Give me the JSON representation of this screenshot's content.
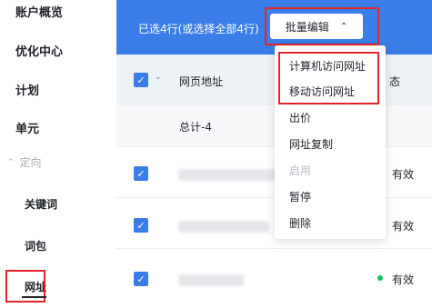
{
  "sidebar": {
    "items": [
      {
        "label": "账户概览"
      },
      {
        "label": "优化中心"
      },
      {
        "label": "计划"
      },
      {
        "label": "单元"
      }
    ],
    "section_label": "定向",
    "sub_items": [
      {
        "label": "关键词"
      },
      {
        "label": "词包"
      },
      {
        "label": "网址"
      }
    ]
  },
  "toolbar": {
    "selection_text": "已选4行(或选择全部4行)",
    "bulk_edit_label": "批量编辑"
  },
  "table": {
    "columns": [
      "网页地址",
      "态"
    ],
    "total_label": "总计-4",
    "rows": [
      {
        "status": "有效",
        "status_color": "#1bbf5b"
      },
      {
        "status": "有效",
        "status_color": "#1bbf5b"
      },
      {
        "status": "有效",
        "status_color": "#1bbf5b"
      }
    ]
  },
  "dropdown": {
    "items": [
      {
        "label": "计算机访问网址",
        "enabled": true
      },
      {
        "label": "移动访问网址",
        "enabled": true
      },
      {
        "label": "出价",
        "enabled": true
      },
      {
        "label": "网址复制",
        "enabled": true
      },
      {
        "label": "启用",
        "enabled": false
      },
      {
        "label": "暂停",
        "enabled": true
      },
      {
        "label": "删除",
        "enabled": true
      }
    ]
  },
  "colors": {
    "accent": "#3a7de8",
    "highlight": "#e3242b"
  }
}
